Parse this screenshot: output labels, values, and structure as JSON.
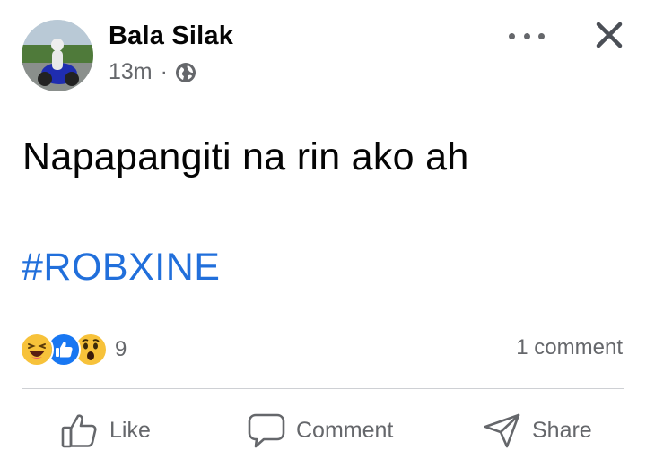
{
  "post": {
    "author": "Bala Silak",
    "time": "13m",
    "separator": "·",
    "text": "Napapangiti na rin ako ah",
    "hashtag": "#ROBXINE"
  },
  "reactions": {
    "icons": [
      "haha-icon",
      "like-icon",
      "wow-icon"
    ],
    "count": "9"
  },
  "comments": {
    "count_label": "1 comment"
  },
  "actions": {
    "like_label": "Like",
    "comment_label": "Comment",
    "share_label": "Share"
  },
  "colors": {
    "hashtag": "#216fdb",
    "like_blue": "#1877f2",
    "secondary_text": "#65676b",
    "emoji_yellow": "#f7c23a"
  }
}
